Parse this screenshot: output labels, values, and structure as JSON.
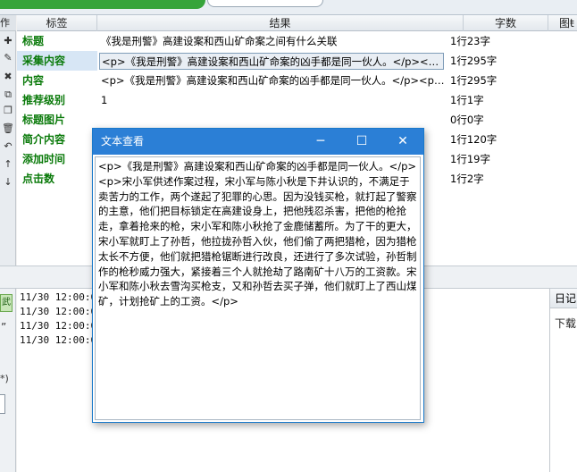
{
  "left_tools": {
    "head_label": "作",
    "icons": [
      "plus-icon",
      "pencil-icon",
      "delete-icon",
      "copy-icon",
      "paste-icon",
      "trash-icon",
      "undo-icon",
      "arrow-up-icon",
      "arrow-down-icon"
    ]
  },
  "grid": {
    "headers": {
      "label": "标签",
      "result": "结果",
      "count": "字数",
      "picture": "图ŧ"
    },
    "rows": [
      {
        "label": "标题",
        "result": "《我是刑警》高建设案和西山矿命案之间有什么关联",
        "count": "1行23字"
      },
      {
        "label": "采集内容",
        "result": "<p>《我是刑警》高建设案和西山矿命案的凶手都是同一伙人。</p><…",
        "count": "1行295字"
      },
      {
        "label": "内容",
        "result": "<p>《我是刑警》高建设案和西山矿命案的凶手都是同一伙人。</p><p…",
        "count": "1行295字"
      },
      {
        "label": "推荐级别",
        "result": "1",
        "count": "1行1字"
      },
      {
        "label": "标题图片",
        "result": "",
        "count": "0行0字"
      },
      {
        "label": "简介内容",
        "result": "",
        "count": "1行120字"
      },
      {
        "label": "添加时间",
        "result": "",
        "count": "1行19字"
      },
      {
        "label": "点击数",
        "result": "",
        "count": "1行2字"
      }
    ]
  },
  "left_panel2": {
    "button": "武",
    "quote": "”",
    "paren": "*)"
  },
  "log": {
    "lines": [
      "11/30 12:00:0",
      "11/30 12:00:0",
      "11/30 12:00:0",
      "11/30 12:00:0"
    ]
  },
  "right_panel": {
    "head": "日记",
    "sub": "下载"
  },
  "dialog": {
    "title": "文本查看",
    "min": "─",
    "max": "☐",
    "close": "✕",
    "text": "<p>《我是刑警》高建设案和西山矿命案的凶手都是同一伙人。</p><p>宋小军供述作案过程，宋小军与陈小秋是下井认识的，不满足于卖苦力的工作，两个遂起了犯罪的心思。因为没钱买枪，就打起了警察的主意，他们把目标锁定在高建设身上，把他残忍杀害，把他的枪抢走，拿着抢来的枪，宋小军和陈小秋抢了金鹿储蓄所。为了干的更大，宋小军就盯上了孙哲，他拉拢孙哲入伙，他们偷了两把猎枪，因为猎枪太长不方便，他们就把猎枪锯断进行改良，还进行了多次试验，孙哲制作的枪秒威力强大，紧接着三个人就抢劫了路南矿十八万的工资款。宋小军和陈小秋去雪沟买枪支，又和孙哲去买子弹，他们就盯上了西山煤矿，计划抢矿上的工资。</p>"
  }
}
